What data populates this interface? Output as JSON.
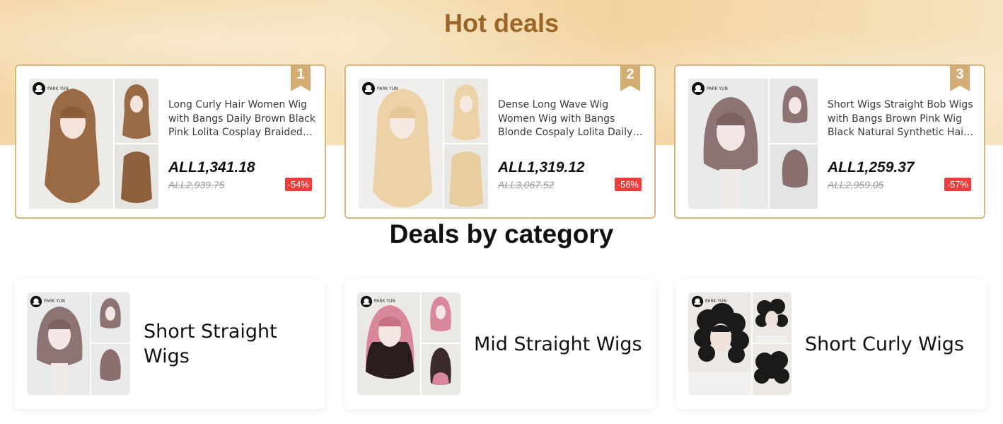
{
  "hot_deals": {
    "title": "Hot deals",
    "items": [
      {
        "rank": "1",
        "title": "Long Curly Hair Women Wig with Bangs Daily Brown Black Pink Lolita Cosplay Braided Synthetic Wig",
        "price": "ALL1,341.18",
        "original_price": "ALL2,939.75",
        "discount": "-54%",
        "brand": "PARK YUN"
      },
      {
        "rank": "2",
        "title": "Dense Long Wave Wig Women Wig with Bangs Blonde Cospaly Lolita Daily Synthetic Wig",
        "price": "ALL1,319.12",
        "original_price": "ALL3,067.52",
        "discount": "-56%",
        "brand": "PARK YUN"
      },
      {
        "rank": "3",
        "title": "Short Wigs Straight Bob Wigs with Bangs Brown Pink Wig Black Natural Synthetic Hair Wig",
        "price": "ALL1,259.37",
        "original_price": "ALL2,959.05",
        "discount": "-57%",
        "brand": "PARK YUN"
      }
    ]
  },
  "categories": {
    "title": "Deals by category",
    "items": [
      {
        "label": "Short Straight Wigs",
        "brand": "PARK YUN"
      },
      {
        "label": "Mid Straight Wigs",
        "brand": "PARK YUN"
      },
      {
        "label": "Short Curly Wigs",
        "brand": "PARK YUN"
      }
    ]
  },
  "colors": {
    "accent_gold": "#d8b67d",
    "title_brown": "#9a6526",
    "discount_red": "#ee3b3b"
  }
}
